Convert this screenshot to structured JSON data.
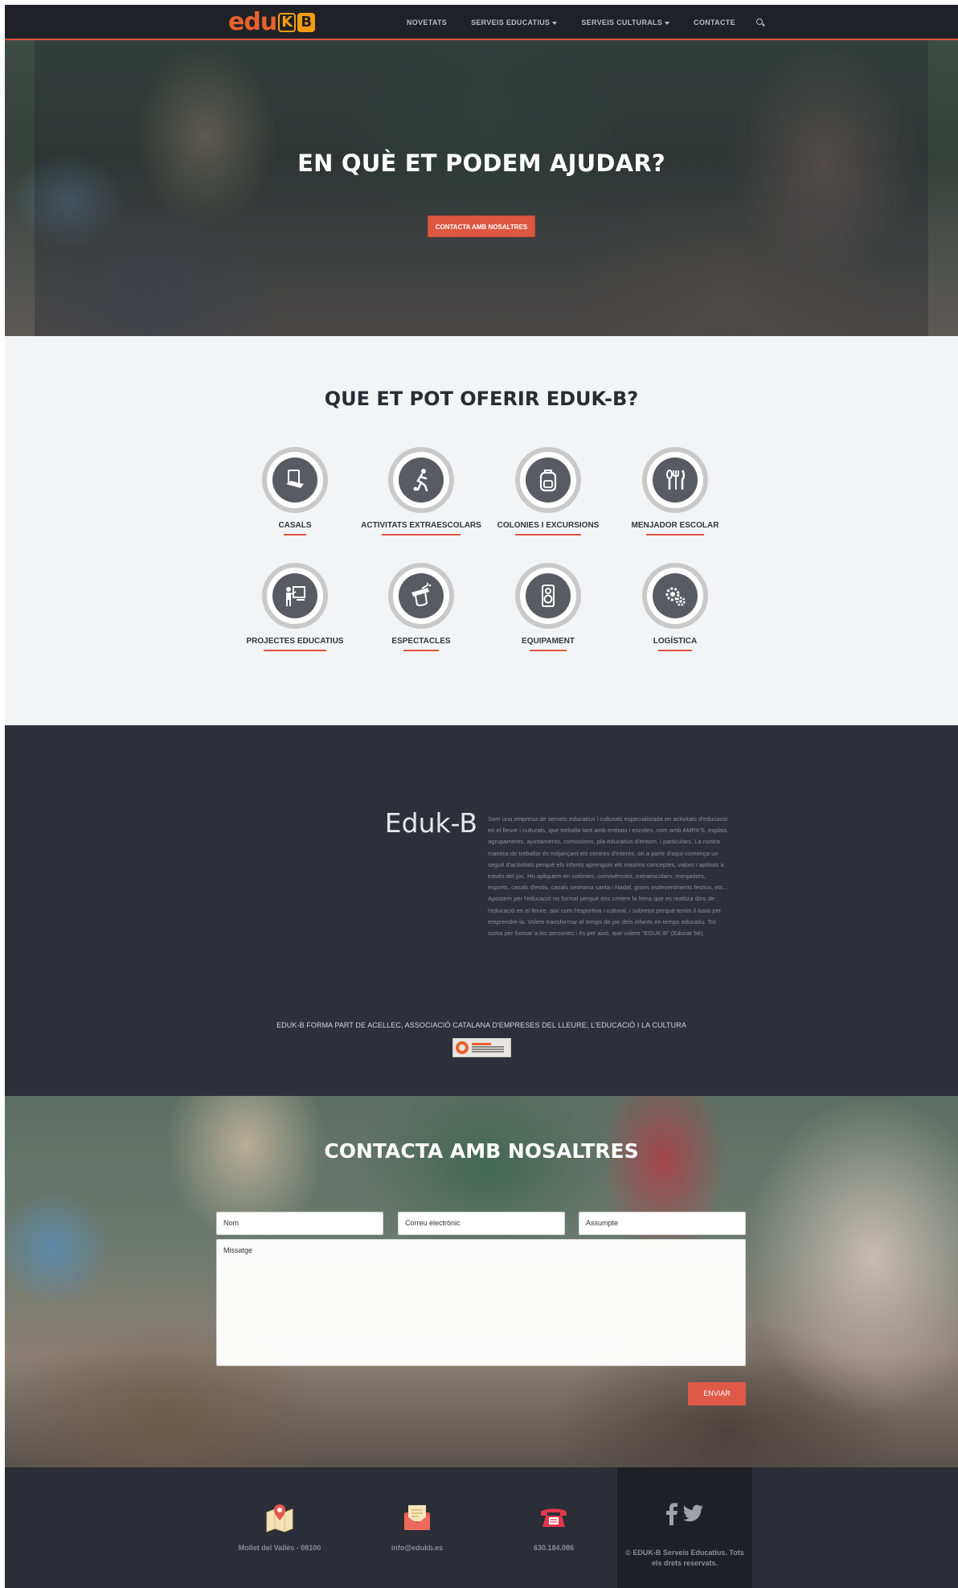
{
  "nav": {
    "logo_part1": "edu",
    "logo_box1": "K",
    "logo_box2": "B",
    "items": [
      {
        "label": "NOVETATS"
      },
      {
        "label": "SERVEIS EDUCATIUS"
      },
      {
        "label": "SERVEIS CULTURALS"
      },
      {
        "label": "CONTACTE"
      }
    ]
  },
  "hero": {
    "title": "EN QUÈ ET PODEM AJUDAR?",
    "button": "CONTACTA AMB NOSALTRES"
  },
  "services": {
    "title": "QUE ET POT OFERIR EDUK-B?",
    "items": [
      {
        "label": "CASALS",
        "icon": "laptop-icon"
      },
      {
        "label": "ACTIVITATS EXTRAESCOLARS",
        "icon": "soccer-player-icon"
      },
      {
        "label": "COLONIES I EXCURSIONS",
        "icon": "backpack-icon"
      },
      {
        "label": "MENJADOR ESCOLAR",
        "icon": "cutlery-icon"
      },
      {
        "label": "PROJECTES EDUCATIUS",
        "icon": "teacher-board-icon"
      },
      {
        "label": "ESPECTACLES",
        "icon": "magic-hat-icon"
      },
      {
        "label": "EQUIPAMENT",
        "icon": "speaker-icon"
      },
      {
        "label": "LOGÍSTICA",
        "icon": "gears-icon"
      }
    ]
  },
  "about": {
    "title": "Eduk-B",
    "text": "Som una empresa de serveis educatius i culturals especialitzada en activitats d'educació en el lleure i culturals, que treballa tant amb entitats i escoles, com amb AMPA'S, esplais, agrupaments, ajuntaments, comissions, pla educatius d'entorn, i particulars. La nostra manera de treballar és mitjançant els centres d'interès, on a partir d'aquí comença un seguit d'activitats perquè els infants aprenguin els màxims conceptes, valors i aptituts a través del joc. Ho apliquem en colònies, convivències, extraescolars, menjadors, esports, casals d'estiu, casals setmana santa i Nadal, grans esdeveniments festius, etc... Apostem per l'educació no formal perquè ens creiem la feina que es realitza dins de l'educació en el lleure, així com l'esportiva i cultural, i sobretot perquè tenim il·lusió per emprendre-la. Volem transformar el temps de joc dels infants en temps educatiu. Tot suma per formar a les persones i és per això, que volem \"EDUK-B\" (Educar bé).",
    "member": "EDUK-B FORMA PART DE ACELLEC, ASSOCIACIÓ CATALANA D'EMPRESES DEL LLEURE, L'EDUCACIÓ I LA CULTURA"
  },
  "contact": {
    "title": "CONTACTA AMB NOSALTRES",
    "name_placeholder": "Nom",
    "email_placeholder": "Correu electrònic",
    "subject_placeholder": "Assumpte",
    "message_placeholder": "Missatge",
    "send": "ENVIAR"
  },
  "footer": {
    "address": "Mollet del Vallès - 08100",
    "email": "info@edukb.es",
    "phone": "630.184.086",
    "copyright": "© EDUK-B Serveis Educatius. Tots els drets reservats."
  },
  "colors": {
    "accent": "#e0543f",
    "dark": "#2d3038",
    "nav": "#1f2127"
  }
}
